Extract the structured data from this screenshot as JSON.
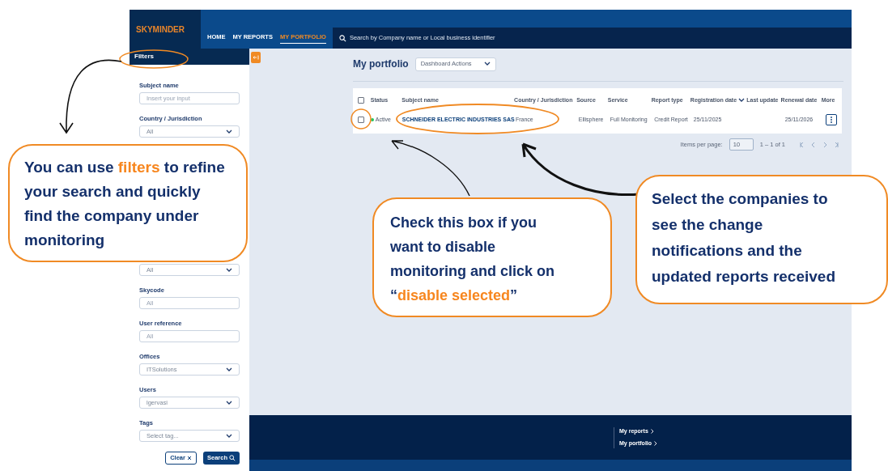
{
  "header": {
    "logo": "SKYMINDER",
    "nav": [
      {
        "label": "HOME",
        "selected": false
      },
      {
        "label": "MY REPORTS",
        "selected": false
      },
      {
        "label": "MY PORTFOLIO",
        "selected": true
      }
    ],
    "search": {
      "placeholder": "Search by Company name or Local business identifier"
    }
  },
  "sidebar": {
    "title": "Filters",
    "filters": [
      {
        "kind": "text",
        "label": "Subject name",
        "placeholder": "Insert your input"
      },
      {
        "kind": "select",
        "label": "Country / Jurisdiction",
        "value": "All"
      },
      {
        "kind": "select",
        "value": "All"
      },
      {
        "kind": "text",
        "label": "Skycode",
        "placeholder": "All"
      },
      {
        "kind": "text",
        "label": "User reference",
        "placeholder": "All"
      },
      {
        "kind": "select",
        "label": "Offices",
        "value": "ITSolutions"
      },
      {
        "kind": "select",
        "label": "Users",
        "value": "lgervasi"
      },
      {
        "kind": "select",
        "label": "Tags",
        "placeholder": "Select tag..."
      }
    ],
    "buttons": [
      {
        "kind": "secondary",
        "label": "Clear"
      },
      {
        "kind": "primary",
        "label": "Search"
      }
    ]
  },
  "main": {
    "title": "My portfolio",
    "actions": "Dashboard Actions",
    "table": {
      "select_all_checked": false,
      "columns": [
        "Status",
        "Subject name",
        "Country / Jurisdiction",
        "Source",
        "Service",
        "Report type",
        "Registration date",
        "Last update",
        "Renewal date",
        "More"
      ],
      "rows": [
        {
          "checked": false,
          "status": "Active",
          "color": "#22c55e",
          "subject": "SCHNEIDER ELECTRIC INDUSTRIES SAS",
          "country": "France",
          "source": "Ellisphere",
          "service": "Full Monitoring",
          "report_type": "Credit Report",
          "registration_date": "25/11/2025",
          "renewal_date": "25/11/2026"
        }
      ]
    },
    "pagination": {
      "label": "Items per page:",
      "per_page": "10",
      "range": "1 – 1 of 1"
    }
  },
  "footer": {
    "links": [
      "My reports",
      "My portfolio"
    ]
  },
  "callouts": [
    {
      "segments": [
        {
          "text": "You can use ",
          "highlight": false
        },
        {
          "text": "filters",
          "highlight": true
        },
        {
          "text": " to refine your search and quickly find the company under monitoring",
          "highlight": false
        }
      ]
    },
    {
      "segments": [
        {
          "text": "Check this box if you want to disable monitoring and click on “",
          "highlight": false
        },
        {
          "text": "disable selected",
          "highlight": true
        },
        {
          "text": "”",
          "highlight": false
        }
      ]
    },
    {
      "segments": [
        {
          "text": "Select the companies to see the change notifications and the updated reports received",
          "highlight": false
        }
      ]
    }
  ]
}
